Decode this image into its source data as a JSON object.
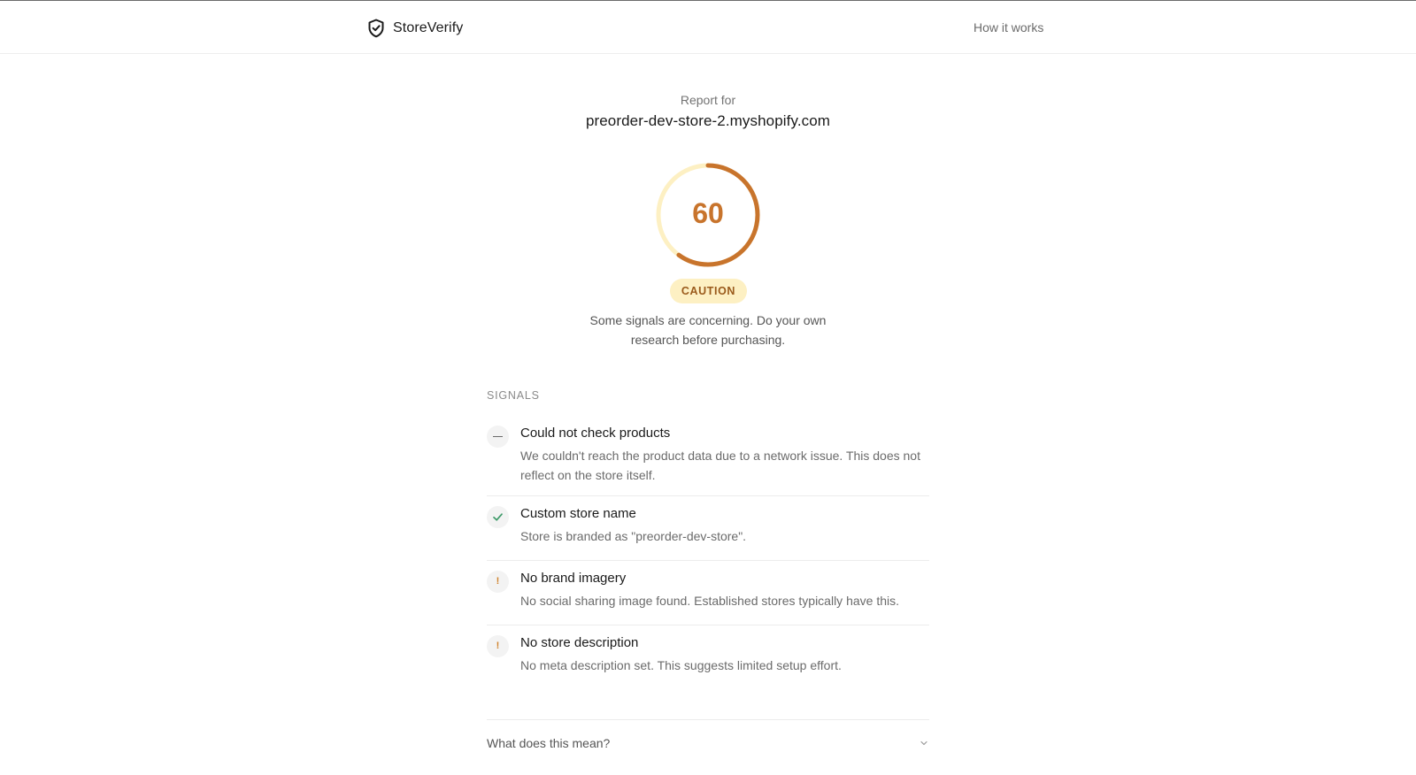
{
  "app": {
    "brand_name": "StoreVerify",
    "brand_icon": "shield-check-icon",
    "nav_link": "How it works"
  },
  "report": {
    "label": "Report for",
    "domain": "preorder-dev-store-2.myshopify.com",
    "score": "60",
    "score_fraction": 0.6,
    "status": "CAUTION",
    "summary": "Some signals are concerning. Do your own research before purchasing.",
    "colors": {
      "gauge_fill": "#c8742c",
      "gauge_track": "#fdf0c3",
      "badge_bg": "#fdf0c3",
      "badge_text": "#9a5a1b"
    }
  },
  "signals": {
    "section_label": "SIGNALS",
    "items": [
      {
        "status": "neutral",
        "icon": "dash-icon",
        "title": "Could not check products",
        "description": "We couldn't reach the product data due to a network issue. This does not reflect on the store itself."
      },
      {
        "status": "pass",
        "icon": "check-icon",
        "title": "Custom store name",
        "description": "Store is branded as \"preorder-dev-store\"."
      },
      {
        "status": "warning",
        "icon": "exclamation-icon",
        "title": "No brand imagery",
        "description": "No social sharing image found. Established stores typically have this."
      },
      {
        "status": "warning",
        "icon": "exclamation-icon",
        "title": "No store description",
        "description": "No meta description set. This suggests limited setup effort."
      }
    ]
  },
  "faq": {
    "question": "What does this mean?",
    "icon": "chevron-down-icon"
  }
}
